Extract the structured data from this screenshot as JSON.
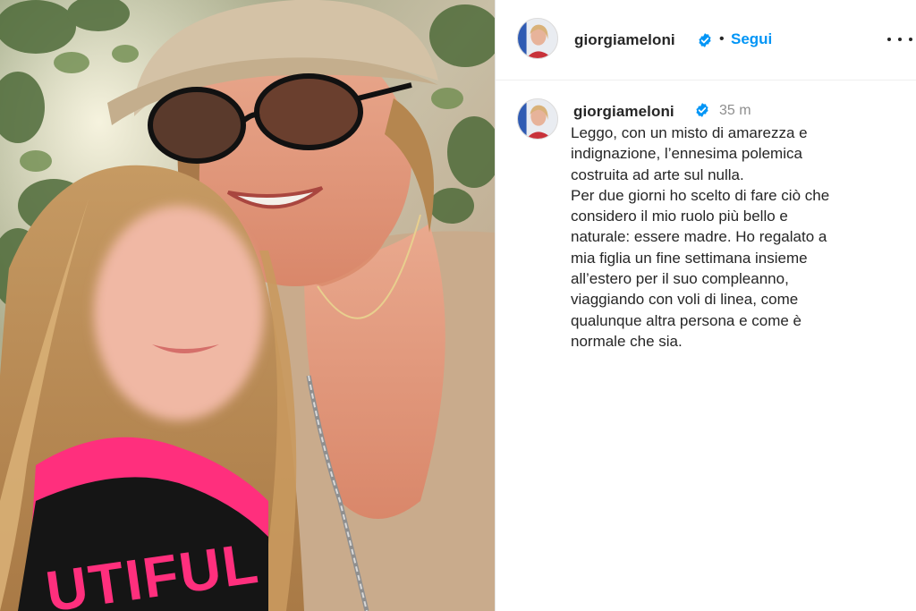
{
  "header": {
    "username": "giorgiameloni",
    "separator": "•",
    "follow_label": "Segui",
    "verified_icon": "verified-badge-icon",
    "more_icon": "more-options-icon"
  },
  "post": {
    "username": "giorgiameloni",
    "time": "35 m",
    "caption": "Leggo, con un misto di amarezza e\nindignazione, l’ennesima polemica\ncostruita ad arte sul nulla.\nPer due giorni ho scelto di fare ciò che\nconsidero il mio ruolo più bello e\nnaturale: essere madre. Ho regalato a\nmia figlia un fine settimana insieme\nall’estero per il suo compleanno,\nviaggiando con voli di linea, come\nqualunque altra persona e come è\nnormale che sia."
  },
  "photo": {
    "shirt_text": "UTIFUL"
  },
  "colors": {
    "follow_blue": "#0095f6",
    "verified_blue": "#0095f6",
    "text": "#262626",
    "muted": "#8e8e8e"
  }
}
